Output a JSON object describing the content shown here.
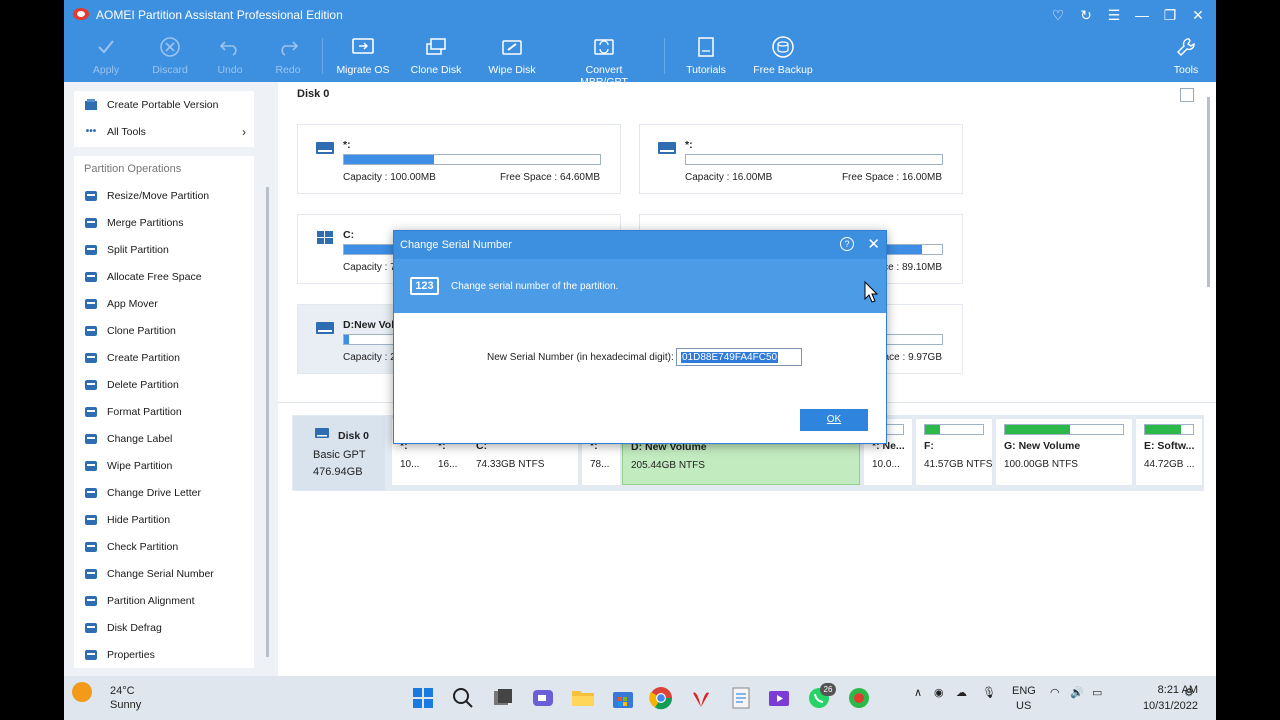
{
  "app": {
    "title": "AOMEI Partition Assistant Professional Edition",
    "accent": "#3d8fe0"
  },
  "toolbar": {
    "apply": "Apply",
    "discard": "Discard",
    "undo": "Undo",
    "redo": "Redo",
    "migrate_os": "Migrate OS",
    "clone_disk": "Clone Disk",
    "wipe_disk": "Wipe Disk",
    "convert": "Convert MBR/GPT",
    "tutorials": "Tutorials",
    "free_backup": "Free Backup",
    "tools": "Tools"
  },
  "sidebar": {
    "top_items": [
      {
        "label": "Create Portable Version",
        "icon": "portable-icon"
      },
      {
        "label": "All Tools",
        "icon": "all-tools-icon"
      }
    ],
    "section_title": "Partition Operations",
    "items": [
      {
        "label": "Resize/Move Partition",
        "icon": "resize-icon"
      },
      {
        "label": "Merge Partitions",
        "icon": "merge-icon"
      },
      {
        "label": "Split Partition",
        "icon": "split-icon"
      },
      {
        "label": "Allocate Free Space",
        "icon": "allocate-icon"
      },
      {
        "label": "App Mover",
        "icon": "app-mover-icon"
      },
      {
        "label": "Clone Partition",
        "icon": "clone-icon"
      },
      {
        "label": "Create Partition",
        "icon": "create-icon"
      },
      {
        "label": "Delete Partition",
        "icon": "delete-icon"
      },
      {
        "label": "Format Partition",
        "icon": "format-icon"
      },
      {
        "label": "Change Label",
        "icon": "label-icon"
      },
      {
        "label": "Wipe Partition",
        "icon": "wipe-icon"
      },
      {
        "label": "Change Drive Letter",
        "icon": "drive-letter-icon"
      },
      {
        "label": "Hide Partition",
        "icon": "hide-icon"
      },
      {
        "label": "Check Partition",
        "icon": "check-icon"
      },
      {
        "label": "Change Serial Number",
        "icon": "serial-icon"
      },
      {
        "label": "Partition Alignment",
        "icon": "alignment-icon"
      },
      {
        "label": "Disk Defrag",
        "icon": "defrag-icon"
      },
      {
        "label": "Properties",
        "icon": "properties-icon"
      }
    ]
  },
  "main": {
    "disk_title": "Disk 0",
    "cards": [
      {
        "name": "*:",
        "capacity": "Capacity : 100.00MB",
        "free": "Free Space : 64.60MB",
        "fill": 0.35
      },
      {
        "name": "*:",
        "capacity": "Capacity : 16.00MB",
        "free": "Free Space : 16.00MB",
        "fill": 0.0
      },
      {
        "name": "C:",
        "capacity": "Capacity : 7",
        "free": "",
        "fill": 0.75
      },
      {
        "name": "",
        "capacity": "",
        "free": "Free Space : 89.10MB",
        "fill": 0.92
      },
      {
        "name": "D:New Volu",
        "capacity": "Capacity : 2",
        "free": "",
        "fill": 0.02
      },
      {
        "name": "",
        "capacity": "",
        "free": "ace : 9.97GB",
        "fill": 0.0
      }
    ]
  },
  "disk_map": {
    "name": "Disk 0",
    "type": "Basic GPT",
    "size": "476.94GB",
    "segments": [
      {
        "name": "*:",
        "info": "10...",
        "fill": 0.35
      },
      {
        "name": "*:",
        "info": "16...",
        "fill": 0.0
      },
      {
        "name": "C:",
        "info": "74.33GB NTFS",
        "fill": 0.75
      },
      {
        "name": "*:",
        "info": "78...",
        "fill": 0.0
      },
      {
        "name": "D: New Volume",
        "info": "205.44GB NTFS",
        "fill": 0.02
      },
      {
        "name": "*: Ne...",
        "info": "10.0...",
        "fill": 0.0
      },
      {
        "name": "F:",
        "info": "41.57GB NTFS",
        "fill": 0.25
      },
      {
        "name": "G: New Volume",
        "info": "100.00GB NTFS",
        "fill": 0.55
      },
      {
        "name": "E: Softw...",
        "info": "44.72GB ...",
        "fill": 0.75
      }
    ]
  },
  "dialog": {
    "title": "Change Serial Number",
    "help": "?",
    "banner_icon_text": "123",
    "banner_text": "Change serial number of the partition.",
    "field_label": "New Serial Number (in hexadecimal digit):",
    "field_value": "01D88E749FA4FC50",
    "ok_label": "OK"
  },
  "taskbar": {
    "temp": "24°C",
    "weather": "Sunny",
    "lang1": "ENG",
    "lang2": "US",
    "time": "8:21 AM",
    "date": "10/31/2022",
    "badge": "26"
  }
}
